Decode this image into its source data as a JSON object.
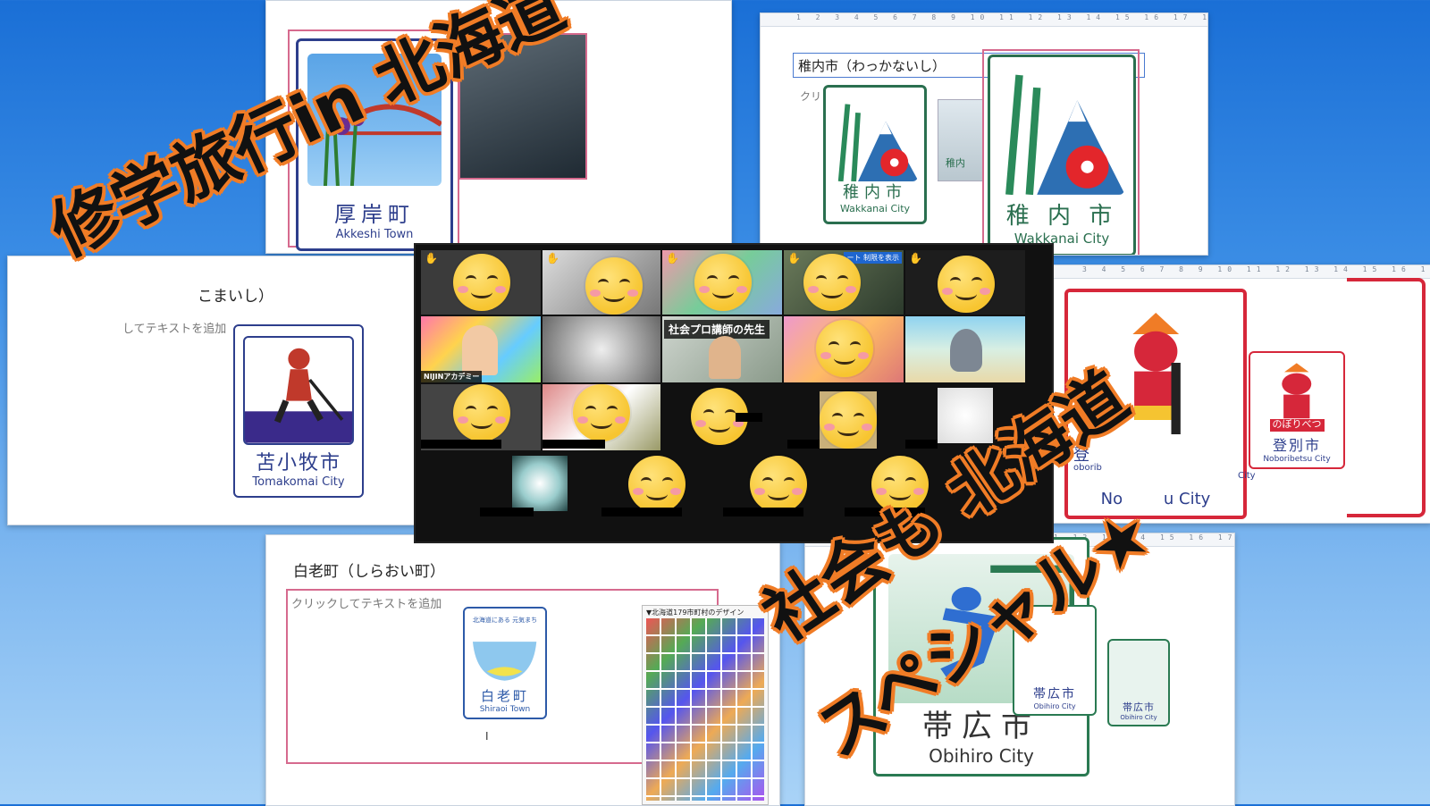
{
  "overlay": {
    "title_line": "修学旅行in 北海道",
    "subtitle_line1": "社会も 北海道",
    "subtitle_line2": "スペシャル★"
  },
  "slides": {
    "akkeshi": {
      "sign_jp": "厚岸町",
      "sign_en": "Akkeshi Town"
    },
    "wakkanai": {
      "title": "稚内市（わっかないし）",
      "hint": "クリ",
      "sign_jp": "稚内市",
      "sign_en": "Wakkanai City",
      "small_sign_jp": "稚内",
      "big_sign_jp": "稚 内 市",
      "big_sign_en": "Wakkanai City"
    },
    "tomakomai": {
      "title": "こまいし）",
      "hint": "してテキストを追加",
      "sign_jp": "苫小牧市",
      "sign_en": "Tomakomai City"
    },
    "noboribetsu": {
      "sign_jp": "登別市",
      "sign_en": "Noboribetsu City",
      "small_jp": "のぼりべつ",
      "partial_jp": "登",
      "partial_en": "oborib",
      "right_edge_text": "City",
      "big_sign_en_partial": "No        u City"
    },
    "shiraoi": {
      "title": "白老町（しらおい町）",
      "hint": "クリックしてテキストを追加",
      "sign_top": "北海道にある 元気まち",
      "sign_jp": "白老町",
      "sign_en": "Shiraoi Town",
      "cursor": "I",
      "thumb_caption": "▼北海道179市町村のデザイン"
    },
    "obihiro": {
      "sign_jp": "帯広市",
      "sign_en": "Obihiro City",
      "small_sign_jp": "帯広市",
      "small_sign_en": "Obihiro City",
      "mini_sign_jp": "帯広市",
      "mini_sign_en": "Obihiro City"
    }
  },
  "zoom": {
    "teacher_label": "社会プロ講師の先生",
    "academy_label": "NIJINアカデミー",
    "banner_label": "ート 制限を表示"
  },
  "colors": {
    "overlay_fill": "#111111",
    "overlay_stroke": "#f07c26",
    "sign_navy": "#2d3e8c",
    "frame_pink": "#d66a8e",
    "sky_blue": "#3d8fe6"
  }
}
